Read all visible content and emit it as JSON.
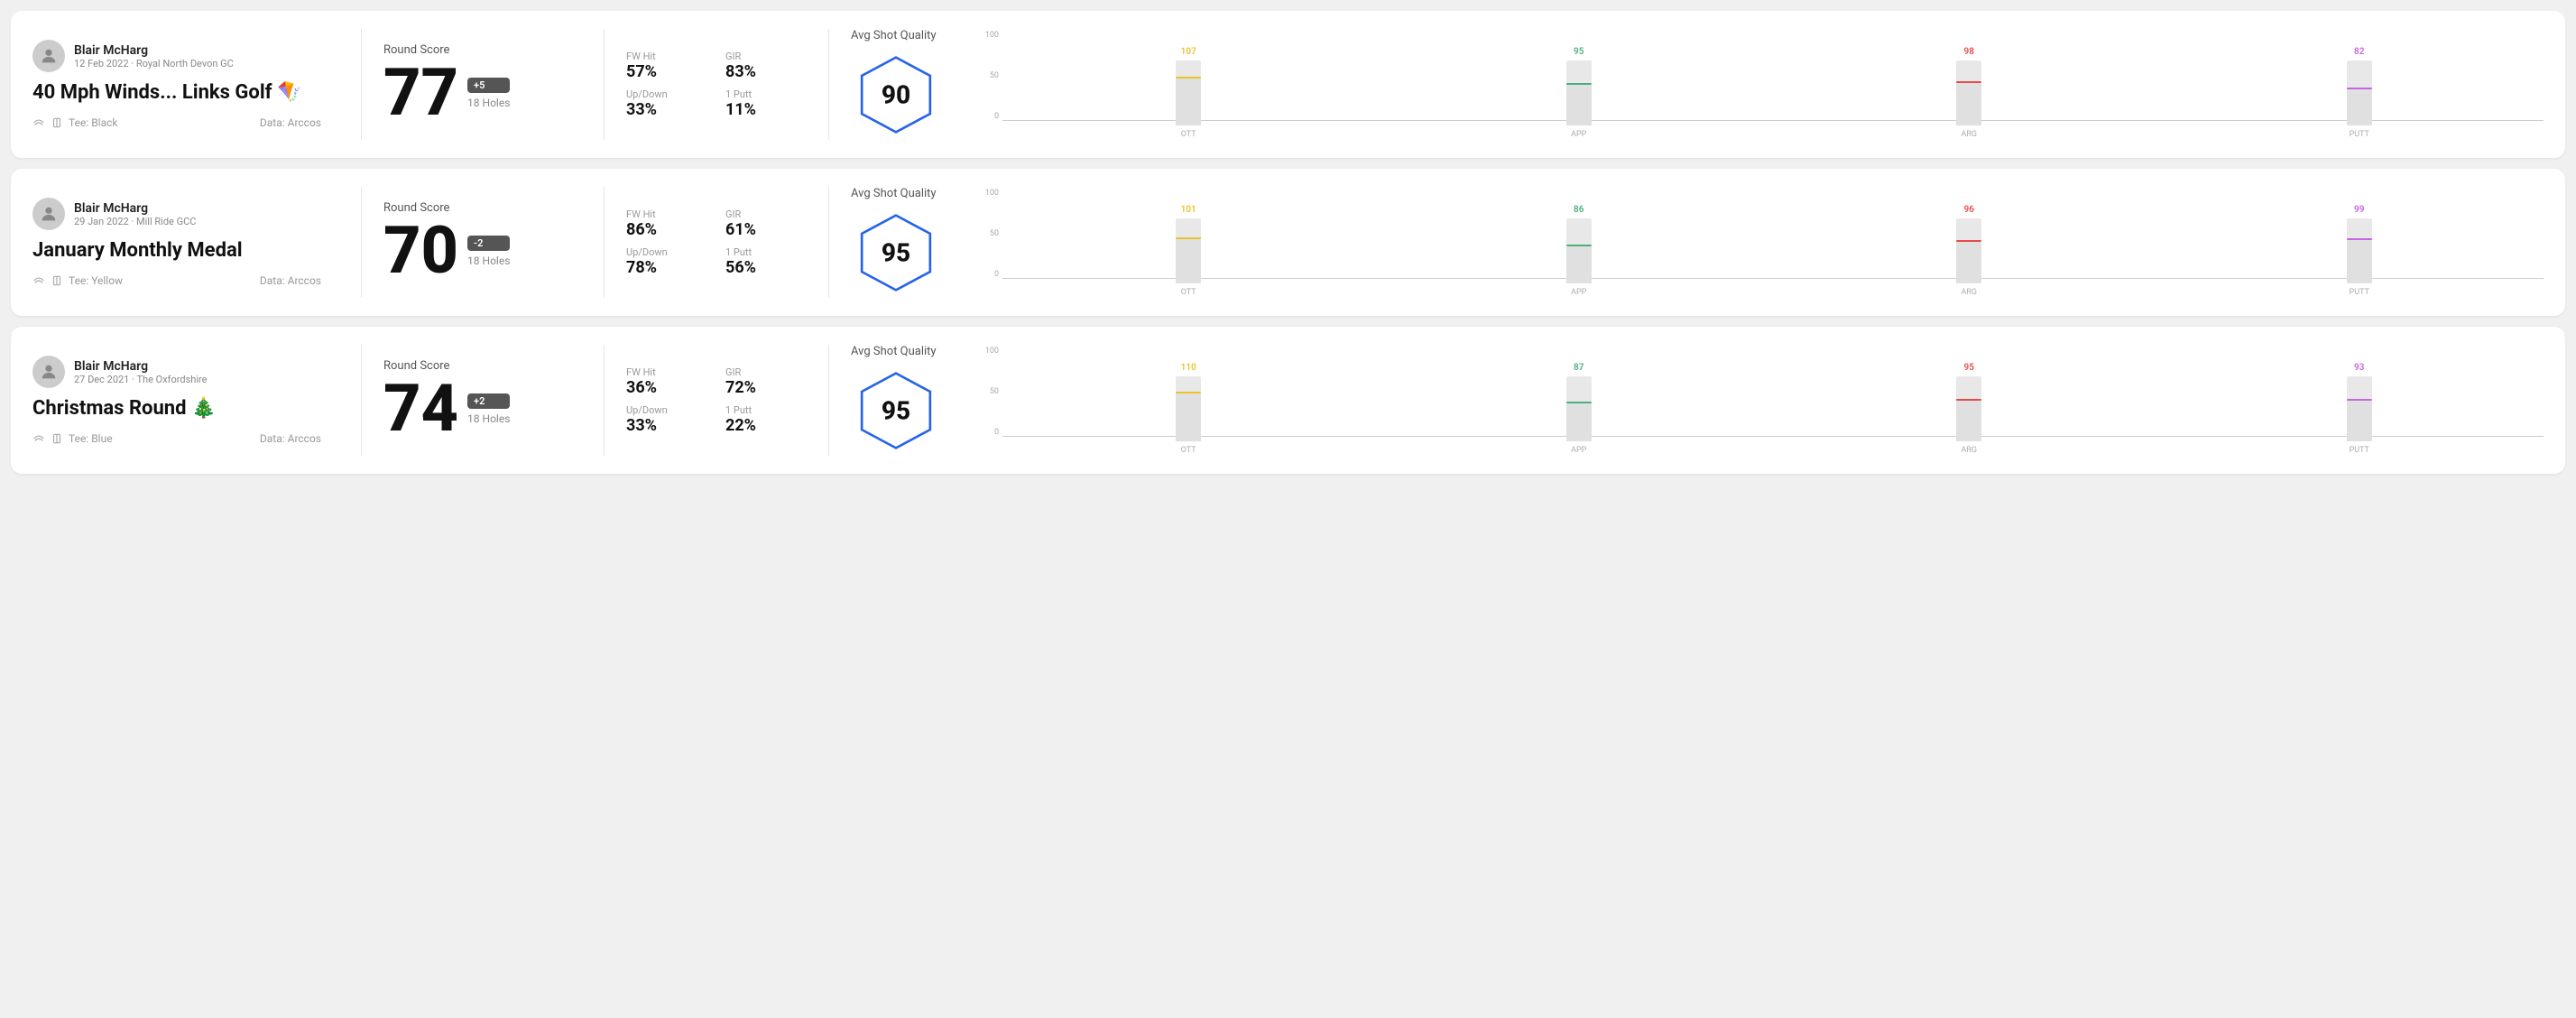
{
  "rounds": [
    {
      "id": "round1",
      "user": {
        "name": "Blair McHarg",
        "date_course": "12 Feb 2022 · Royal North Devon GC"
      },
      "title": "40 Mph Winds... Links Golf 🪁",
      "tee": "Tee: Black",
      "data_source": "Data: Arccos",
      "round_score_label": "Round Score",
      "score": "77",
      "score_badge": "+5",
      "holes": "18 Holes",
      "fw_hit_label": "FW Hit",
      "fw_hit": "57%",
      "gir_label": "GIR",
      "gir": "83%",
      "updown_label": "Up/Down",
      "updown": "33%",
      "oneputt_label": "1 Putt",
      "oneputt": "11%",
      "avg_quality_label": "Avg Shot Quality",
      "quality_score": "90",
      "chart": {
        "bars": [
          {
            "label": "OTT",
            "top_value": "107",
            "color": "#e8c42a",
            "fill_pct": 72
          },
          {
            "label": "APP",
            "top_value": "95",
            "color": "#4caf7d",
            "fill_pct": 62
          },
          {
            "label": "ARG",
            "top_value": "98",
            "color": "#e84a4a",
            "fill_pct": 65
          },
          {
            "label": "PUTT",
            "top_value": "82",
            "color": "#c964e0",
            "fill_pct": 55
          }
        ],
        "y_labels": [
          "100",
          "50",
          "0"
        ]
      }
    },
    {
      "id": "round2",
      "user": {
        "name": "Blair McHarg",
        "date_course": "29 Jan 2022 · Mill Ride GCC"
      },
      "title": "January Monthly Medal",
      "tee": "Tee: Yellow",
      "data_source": "Data: Arccos",
      "round_score_label": "Round Score",
      "score": "70",
      "score_badge": "-2",
      "holes": "18 Holes",
      "fw_hit_label": "FW Hit",
      "fw_hit": "86%",
      "gir_label": "GIR",
      "gir": "61%",
      "updown_label": "Up/Down",
      "updown": "78%",
      "oneputt_label": "1 Putt",
      "oneputt": "56%",
      "avg_quality_label": "Avg Shot Quality",
      "quality_score": "95",
      "chart": {
        "bars": [
          {
            "label": "OTT",
            "top_value": "101",
            "color": "#e8c42a",
            "fill_pct": 68
          },
          {
            "label": "APP",
            "top_value": "86",
            "color": "#4caf7d",
            "fill_pct": 57
          },
          {
            "label": "ARG",
            "top_value": "96",
            "color": "#e84a4a",
            "fill_pct": 64
          },
          {
            "label": "PUTT",
            "top_value": "99",
            "color": "#c964e0",
            "fill_pct": 66
          }
        ],
        "y_labels": [
          "100",
          "50",
          "0"
        ]
      }
    },
    {
      "id": "round3",
      "user": {
        "name": "Blair McHarg",
        "date_course": "27 Dec 2021 · The Oxfordshire"
      },
      "title": "Christmas Round 🎄",
      "tee": "Tee: Blue",
      "data_source": "Data: Arccos",
      "round_score_label": "Round Score",
      "score": "74",
      "score_badge": "+2",
      "holes": "18 Holes",
      "fw_hit_label": "FW Hit",
      "fw_hit": "36%",
      "gir_label": "GIR",
      "gir": "72%",
      "updown_label": "Up/Down",
      "updown": "33%",
      "oneputt_label": "1 Putt",
      "oneputt": "22%",
      "avg_quality_label": "Avg Shot Quality",
      "quality_score": "95",
      "chart": {
        "bars": [
          {
            "label": "OTT",
            "top_value": "110",
            "color": "#e8c42a",
            "fill_pct": 73
          },
          {
            "label": "APP",
            "top_value": "87",
            "color": "#4caf7d",
            "fill_pct": 58
          },
          {
            "label": "ARG",
            "top_value": "95",
            "color": "#e84a4a",
            "fill_pct": 63
          },
          {
            "label": "PUTT",
            "top_value": "93",
            "color": "#c964e0",
            "fill_pct": 62
          }
        ],
        "y_labels": [
          "100",
          "50",
          "0"
        ]
      }
    }
  ]
}
